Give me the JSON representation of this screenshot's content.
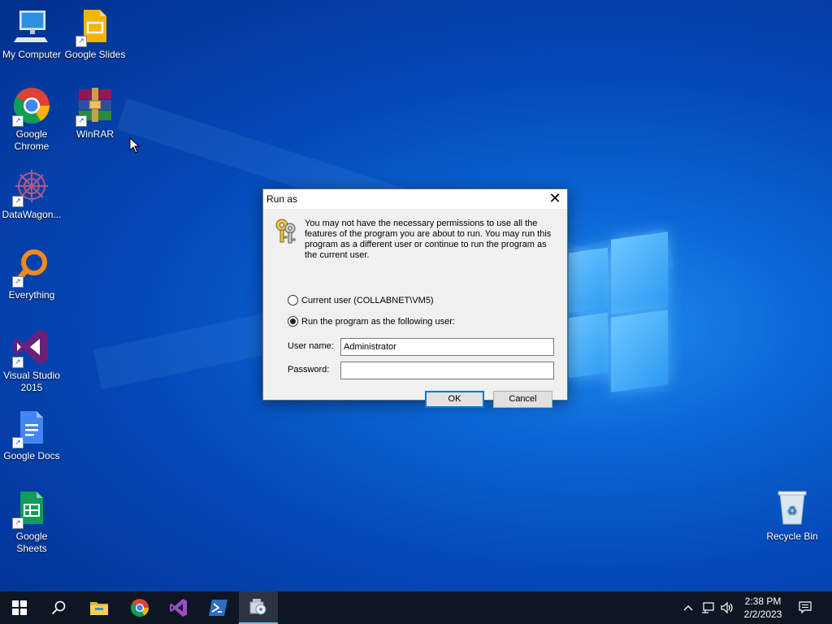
{
  "desktop_icons": [
    {
      "label": "My Computer",
      "icon": "computer-icon"
    },
    {
      "label": "Google Slides",
      "icon": "google-slides-icon"
    },
    {
      "label": "Google Chrome",
      "icon": "chrome-icon"
    },
    {
      "label": "WinRAR",
      "icon": "winrar-icon"
    },
    {
      "label": "DataWagon...",
      "icon": "datawagon-icon"
    },
    {
      "label": "Everything",
      "icon": "everything-icon"
    },
    {
      "label": "Visual Studio 2015",
      "icon": "visual-studio-icon"
    },
    {
      "label": "Google Docs",
      "icon": "google-docs-icon"
    },
    {
      "label": "Google Sheets",
      "icon": "google-sheets-icon"
    },
    {
      "label": "Recycle Bin",
      "icon": "recycle-bin-icon"
    }
  ],
  "dialog": {
    "title": "Run as",
    "close_glyph": "✕",
    "message": "You may not have the necessary permissions to use all the features of the program you are about to run. You may run this program as a different user or continue to run the program as the current user.",
    "option_current": "Current user (COLLABNET\\VM5)",
    "option_other": "Run the program as the following user:",
    "selected_option": "other",
    "username_label": "User name:",
    "username_value": "Administrator",
    "password_label": "Password:",
    "password_value": "",
    "ok_label": "OK",
    "cancel_label": "Cancel"
  },
  "taskbar": {
    "buttons": [
      "start-icon",
      "search-icon",
      "file-explorer-icon",
      "chrome-icon",
      "visual-studio-icon",
      "powershell-icon",
      "runas-app-icon"
    ],
    "active_button": "runas-app-icon",
    "tray_icons": [
      "chevron-up-icon",
      "network-icon",
      "volume-icon"
    ],
    "time": "2:38 PM",
    "date": "2/2/2023",
    "notification_icon": "notification-icon"
  },
  "colors": {
    "desktop_blue": "#0b67d6",
    "taskbar": "#0f1623",
    "accent": "#0078d7"
  }
}
